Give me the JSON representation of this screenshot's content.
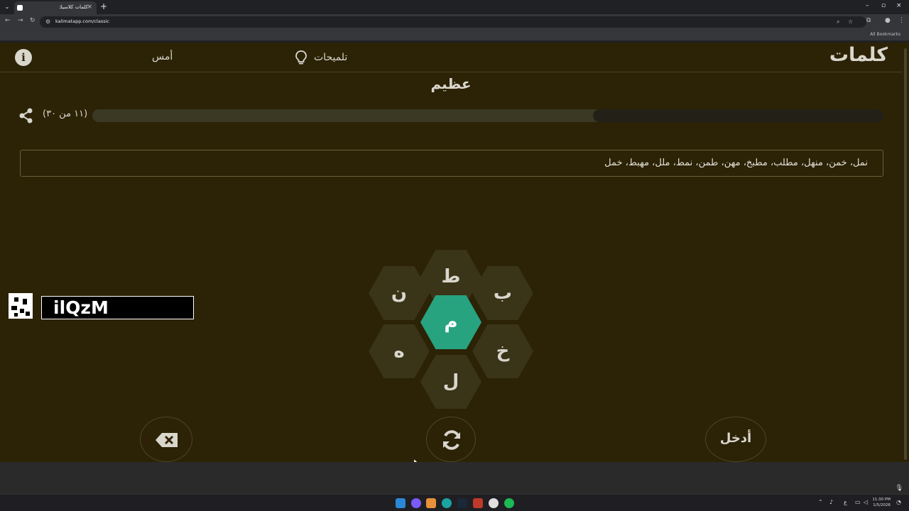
{
  "browser": {
    "tab_title": "كلمات كلاسيك",
    "url": "kalimatapp.com/classic",
    "bookmarks_label": "All Bookmarks"
  },
  "header": {
    "logo": "كلمات",
    "hints_label": "تلميحات",
    "yesterday_label": "أمس"
  },
  "rank": "عظيم",
  "score": {
    "text": "(١١ من ٣٠)",
    "found": 11,
    "total": 30,
    "progress_fraction": 0.367
  },
  "found_words": "نمل، خمن، منهل، مطلب، مطبخ، مهن، طمن، نمط، ملل، مهبط، خمل",
  "letters": {
    "center": "م",
    "outer": [
      "ط",
      "ب",
      "خ",
      "ل",
      "ه",
      "ن"
    ]
  },
  "controls": {
    "enter_label": "أدخل"
  },
  "overlay_code": "ilQzM",
  "taskbar": {
    "time": "11:30 PM",
    "date": "1/5/2026"
  },
  "colors": {
    "background": "#2c2206",
    "center_hex": "#27a380",
    "outer_hex": "#3a3418",
    "text": "#d9d6cc"
  }
}
